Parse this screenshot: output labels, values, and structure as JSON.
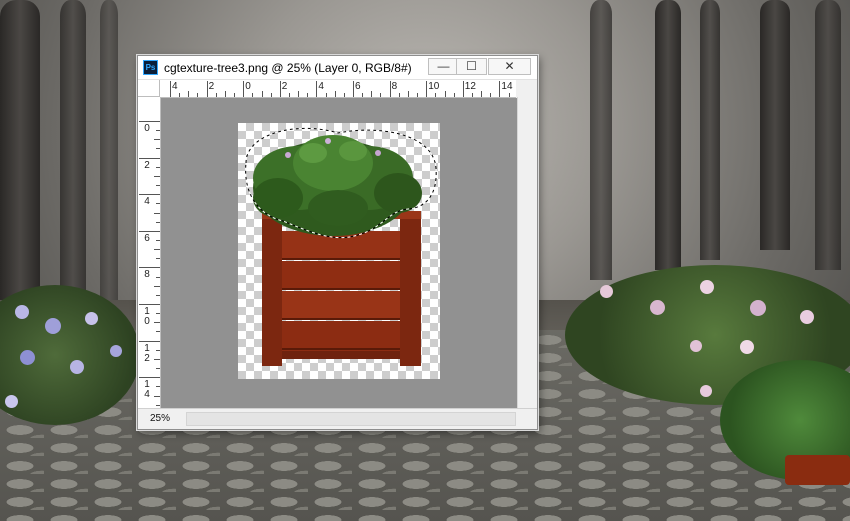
{
  "window": {
    "title": "cgtexture-tree3.png @ 25% (Layer 0, RGB/8#)",
    "app_icon_label": "Ps",
    "controls": {
      "minimize": "—",
      "maximize": "☐",
      "close": "✕"
    }
  },
  "rulers": {
    "horizontal": [
      "4",
      "2",
      "0",
      "2",
      "4",
      "6",
      "8",
      "10",
      "12",
      "14"
    ],
    "vertical": [
      "0",
      "2",
      "4",
      "6",
      "8",
      "10",
      "12",
      "14"
    ]
  },
  "status": {
    "zoom": "25%"
  },
  "colors": {
    "ps_icon_bg": "#0b1f3a",
    "ps_icon_fg": "#31a8ff",
    "canvas_bg": "#919191",
    "pot_wood": "#8f2d12"
  }
}
